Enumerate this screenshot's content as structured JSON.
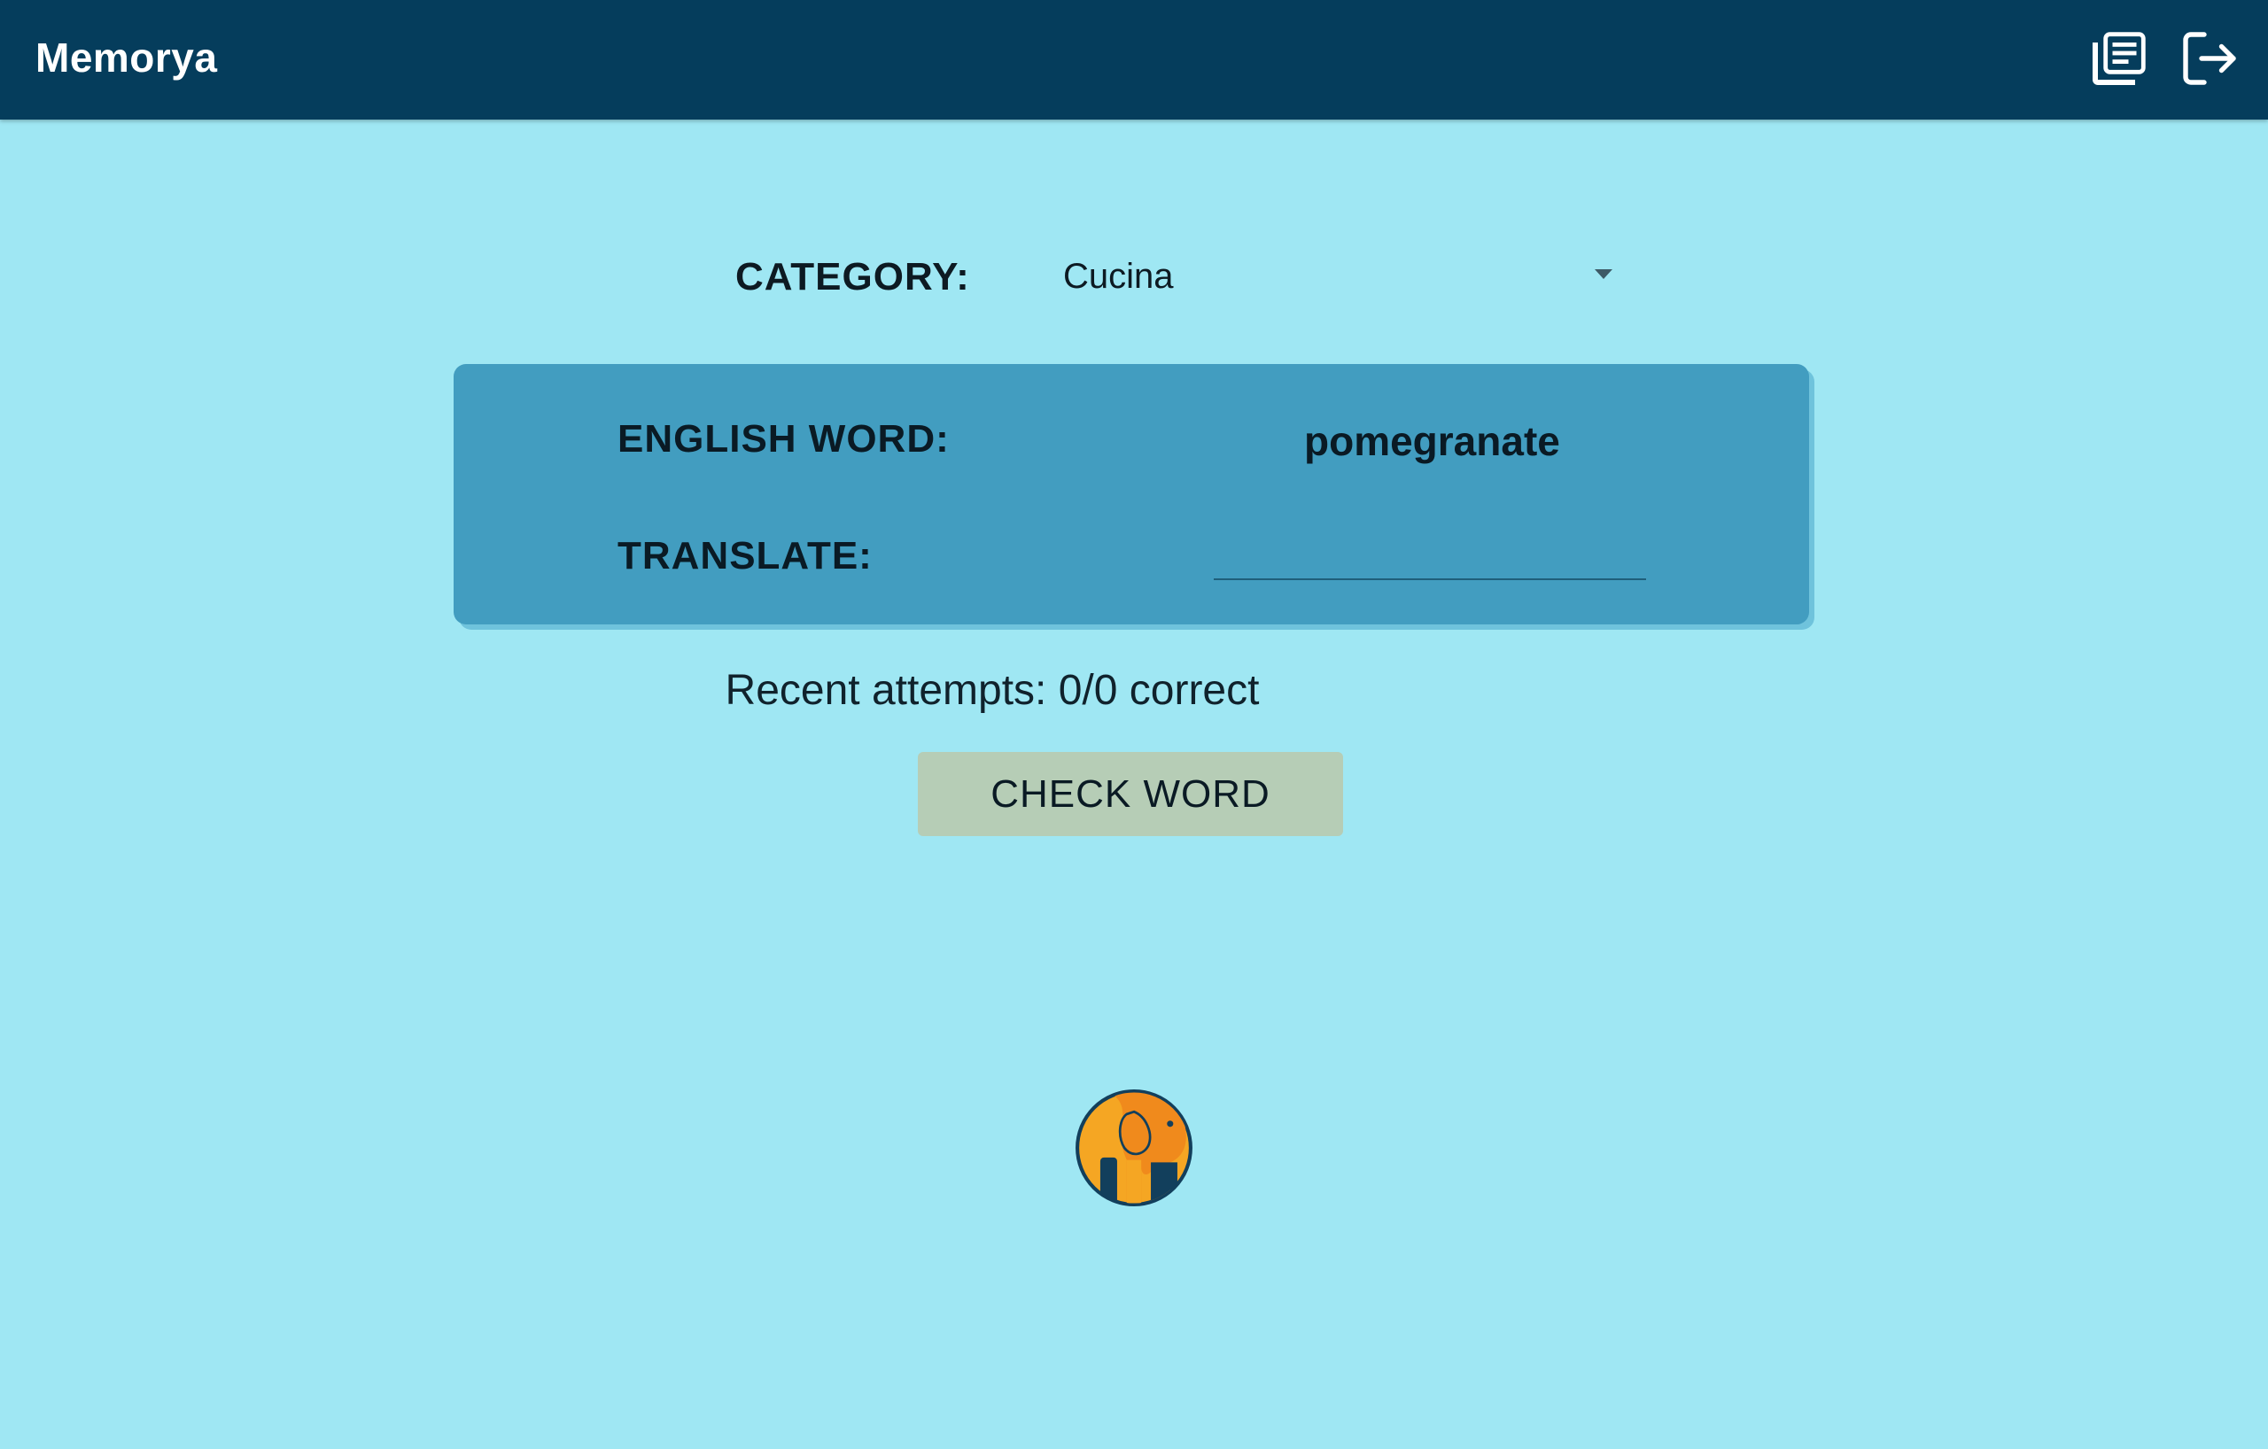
{
  "header": {
    "title": "Memorya",
    "icons": [
      "word-list-icon",
      "logout-icon"
    ]
  },
  "category": {
    "label": "CATEGORY:",
    "selected": "Cucina"
  },
  "card": {
    "english_label": "ENGLISH WORD:",
    "english_word": "pomegranate",
    "translate_label": "TRANSLATE:",
    "translate_value": ""
  },
  "attempts": {
    "text": "Recent attempts: 0/0 correct"
  },
  "actions": {
    "check_label": "CHECK WORD"
  },
  "colors": {
    "topbar": "#053d5c",
    "background": "#9fe7f3",
    "card": "#429dc0",
    "button": "#b6cdb6",
    "logo_orange": "#f08a1c",
    "logo_yellow": "#f5a623",
    "logo_navy": "#123f5c"
  }
}
